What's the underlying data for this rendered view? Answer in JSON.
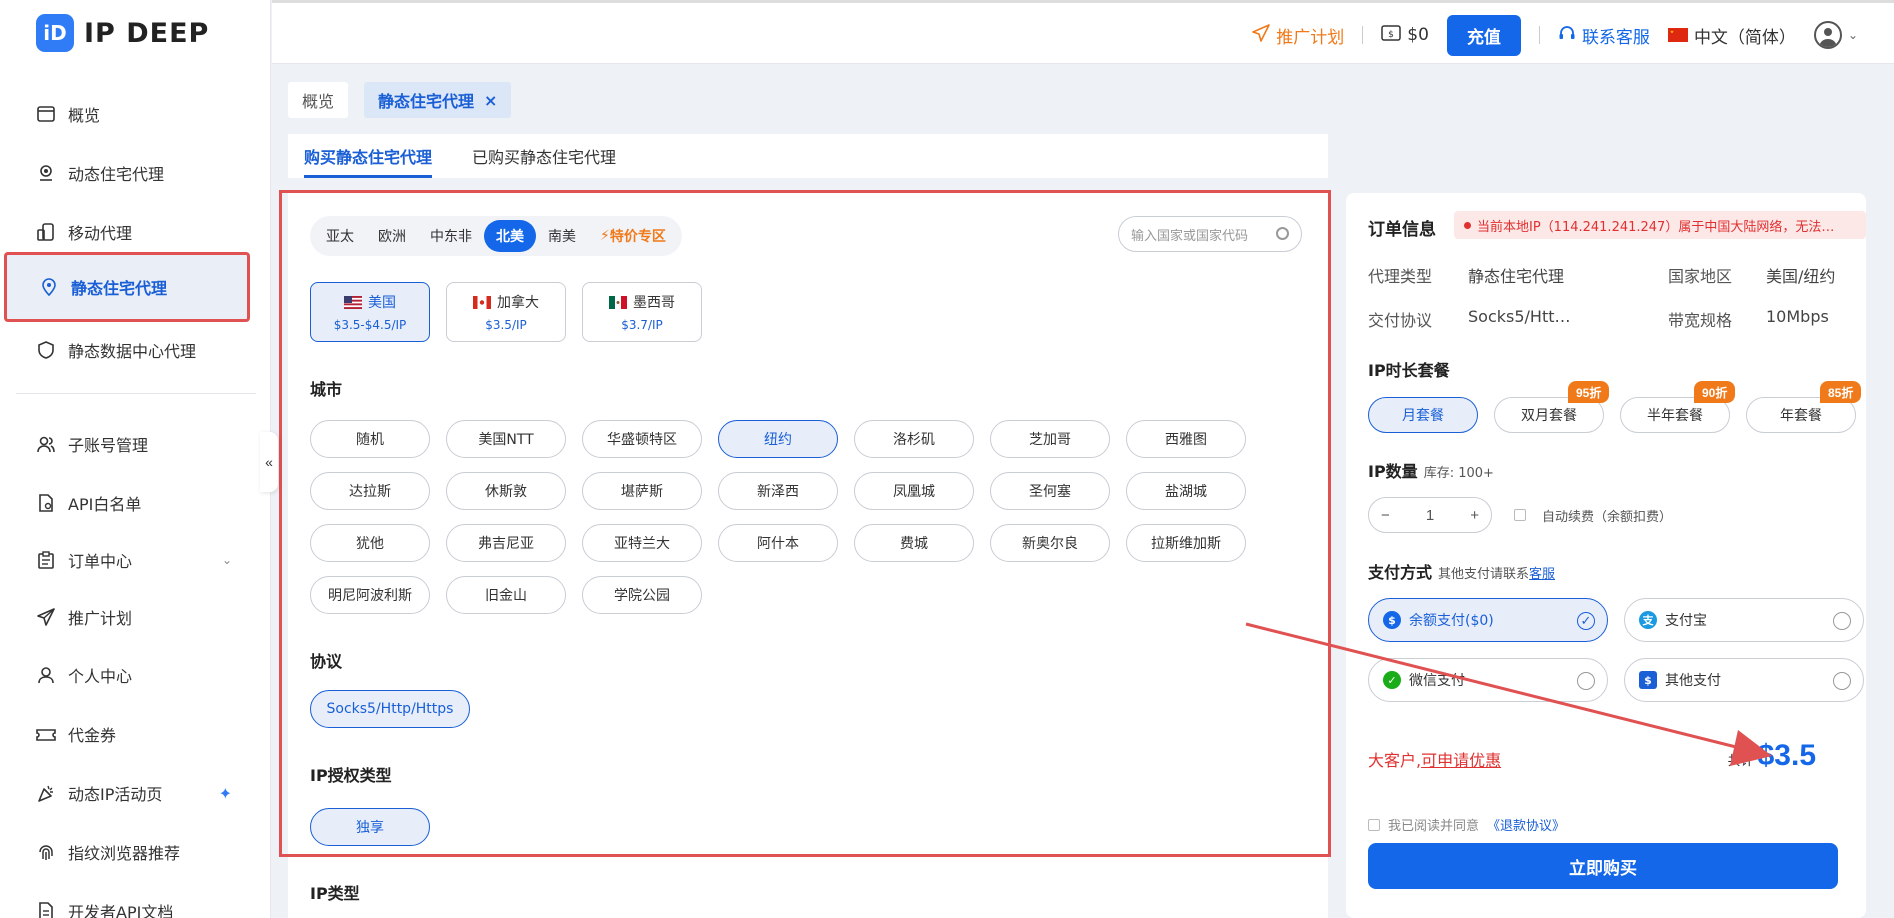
{
  "brand": {
    "name": "IP DEEP",
    "mark": "iD"
  },
  "topbar": {
    "promo": "推广计划",
    "balance": "$0",
    "recharge": "充值",
    "support": "联系客服",
    "language": "中文（简体）"
  },
  "nav": {
    "overview": "概览",
    "dynamic": "动态住宅代理",
    "mobile": "移动代理",
    "static": "静态住宅代理",
    "datacenter": "静态数据中心代理",
    "subaccount": "子账号管理",
    "whitelist": "API白名单",
    "orders": "订单中心",
    "affiliate": "推广计划",
    "profile": "个人中心",
    "voucher": "代金券",
    "activity": "动态IP活动页",
    "browser": "指纹浏览器推荐",
    "devapi": "开发者API文档"
  },
  "tabs": {
    "overview": "概览",
    "static": "静态住宅代理",
    "close": "×"
  },
  "subtabs": {
    "buy": "购买静态住宅代理",
    "bought": "已购买静态住宅代理"
  },
  "regions": [
    "亚太",
    "欧洲",
    "中东非",
    "北美",
    "南美",
    "特价专区"
  ],
  "country_search": {
    "placeholder": "输入国家或国家代码"
  },
  "countries": [
    {
      "name": "美国",
      "price": "$3.5-$4.5/IP"
    },
    {
      "name": "加拿大",
      "price": "$3.5/IP"
    },
    {
      "name": "墨西哥",
      "price": "$3.7/IP"
    }
  ],
  "sections": {
    "city": "城市",
    "protocol": "协议",
    "auth": "IP授权类型",
    "iptype": "IP类型"
  },
  "cities": [
    "随机",
    "美国NTT",
    "华盛顿特区",
    "纽约",
    "洛杉矶",
    "芝加哥",
    "西雅图",
    "达拉斯",
    "休斯敦",
    "堪萨斯",
    "新泽西",
    "凤凰城",
    "圣何塞",
    "盐湖城",
    "犹他",
    "弗吉尼亚",
    "亚特兰大",
    "阿什本",
    "费城",
    "新奥尔良",
    "拉斯维加斯",
    "明尼阿波利斯",
    "旧金山",
    "学院公园"
  ],
  "protocol": "Socks5/Http/Https",
  "auth": "独享",
  "order": {
    "title": "订单信息",
    "warning": "当前本地IP（114.241.241.247）属于中国大陆网络，无法…",
    "proxy_type_label": "代理类型",
    "proxy_type": "静态住宅代理",
    "region_label": "国家地区",
    "region": "美国/纽约",
    "protocol_label": "交付协议",
    "protocol": "Socks5/Htt…",
    "bandwidth_label": "带宽规格",
    "bandwidth": "10Mbps",
    "duration_title": "IP时长套餐",
    "plans": [
      {
        "name": "月套餐",
        "badge": ""
      },
      {
        "name": "双月套餐",
        "badge": "95折"
      },
      {
        "name": "半年套餐",
        "badge": "90折"
      },
      {
        "name": "年套餐",
        "badge": "85折"
      }
    ],
    "qty_title": "IP数量",
    "stock": "库存: 100+",
    "qty": "1",
    "minus": "−",
    "plus": "+",
    "auto_renew": "自动续费（余额扣费）",
    "pay_title": "支付方式",
    "pay_note": "其他支付请联系",
    "pay_link": "客服",
    "pay_methods": [
      "余额支付($0)",
      "支付宝",
      "微信支付",
      "其他支付"
    ],
    "vip": "大客户,",
    "vip_link": "可申请优惠",
    "total_label": "共计",
    "total": "$3.5",
    "agree": "我已阅读并同意",
    "agree_link": "《退款协议》",
    "buy": "立即购买"
  },
  "colors": {
    "primary": "#1367e8",
    "accent": "#f07a1a",
    "annotation": "#e05252"
  }
}
